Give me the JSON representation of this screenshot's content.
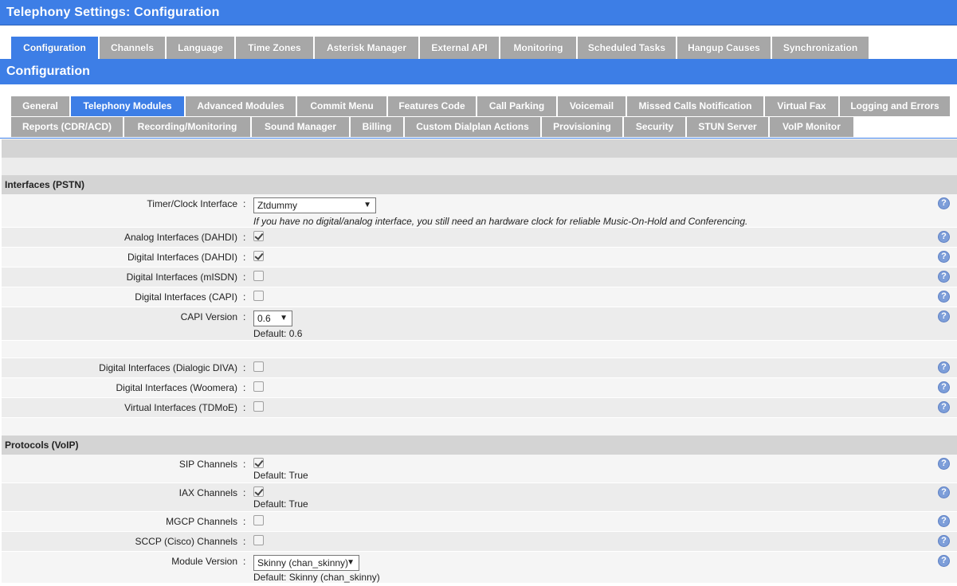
{
  "title": "Telephony Settings:  Configuration",
  "top_tabs": [
    "Configuration",
    "Channels",
    "Language",
    "Time Zones",
    "Asterisk Manager",
    "External API",
    "Monitoring",
    "Scheduled Tasks",
    "Hangup Causes",
    "Synchronization"
  ],
  "section_title": "Configuration",
  "sub_tabs_row1": [
    "General",
    "Telephony Modules",
    "Advanced Modules",
    "Commit Menu",
    "Features Code",
    "Call Parking",
    "Voicemail",
    "Missed Calls Notification",
    "Virtual Fax",
    "Logging and Errors"
  ],
  "sub_tabs_row2": [
    "Reports (CDR/ACD)",
    "Recording/Monitoring",
    "Sound Manager",
    "Billing",
    "Custom Dialplan Actions",
    "Provisioning",
    "Security",
    "STUN Server",
    "VoIP Monitor"
  ],
  "interfaces": {
    "heading": "Interfaces (PSTN)",
    "timer_label": "Timer/Clock Interface",
    "timer_value": "Ztdummy",
    "timer_hint": "If you have no digital/analog interface, you still need an hardware clock for reliable Music-On-Hold and Conferencing.",
    "analog_label": "Analog Interfaces (DAHDI)",
    "digital_dahdi_label": "Digital Interfaces (DAHDI)",
    "misdn_label": "Digital Interfaces (mISDN)",
    "capi_label": "Digital Interfaces (CAPI)",
    "capi_version_label": "CAPI Version",
    "capi_version_value": "0.6",
    "capi_version_default": "Default: 0.6",
    "diva_label": "Digital Interfaces (Dialogic DIVA)",
    "woomera_label": "Digital Interfaces (Woomera)",
    "tdmoe_label": "Virtual Interfaces (TDMoE)"
  },
  "protocols": {
    "heading": "Protocols (VoIP)",
    "sip_label": "SIP Channels",
    "sip_default": "Default: True",
    "iax_label": "IAX Channels",
    "iax_default": "Default: True",
    "mgcp_label": "MGCP Channels",
    "sccp_label": "SCCP (Cisco) Channels",
    "module_version_label": "Module Version",
    "module_version_value": "Skinny (chan_skinny)",
    "module_version_default": "Default: Skinny (chan_skinny)"
  },
  "colon": ":",
  "help_glyph": "?",
  "dropdown_glyph": "▼",
  "colors": {
    "accent": "#3d7ee6",
    "tab_inactive": "#a7a7a7",
    "help": "#7d9ed9"
  }
}
